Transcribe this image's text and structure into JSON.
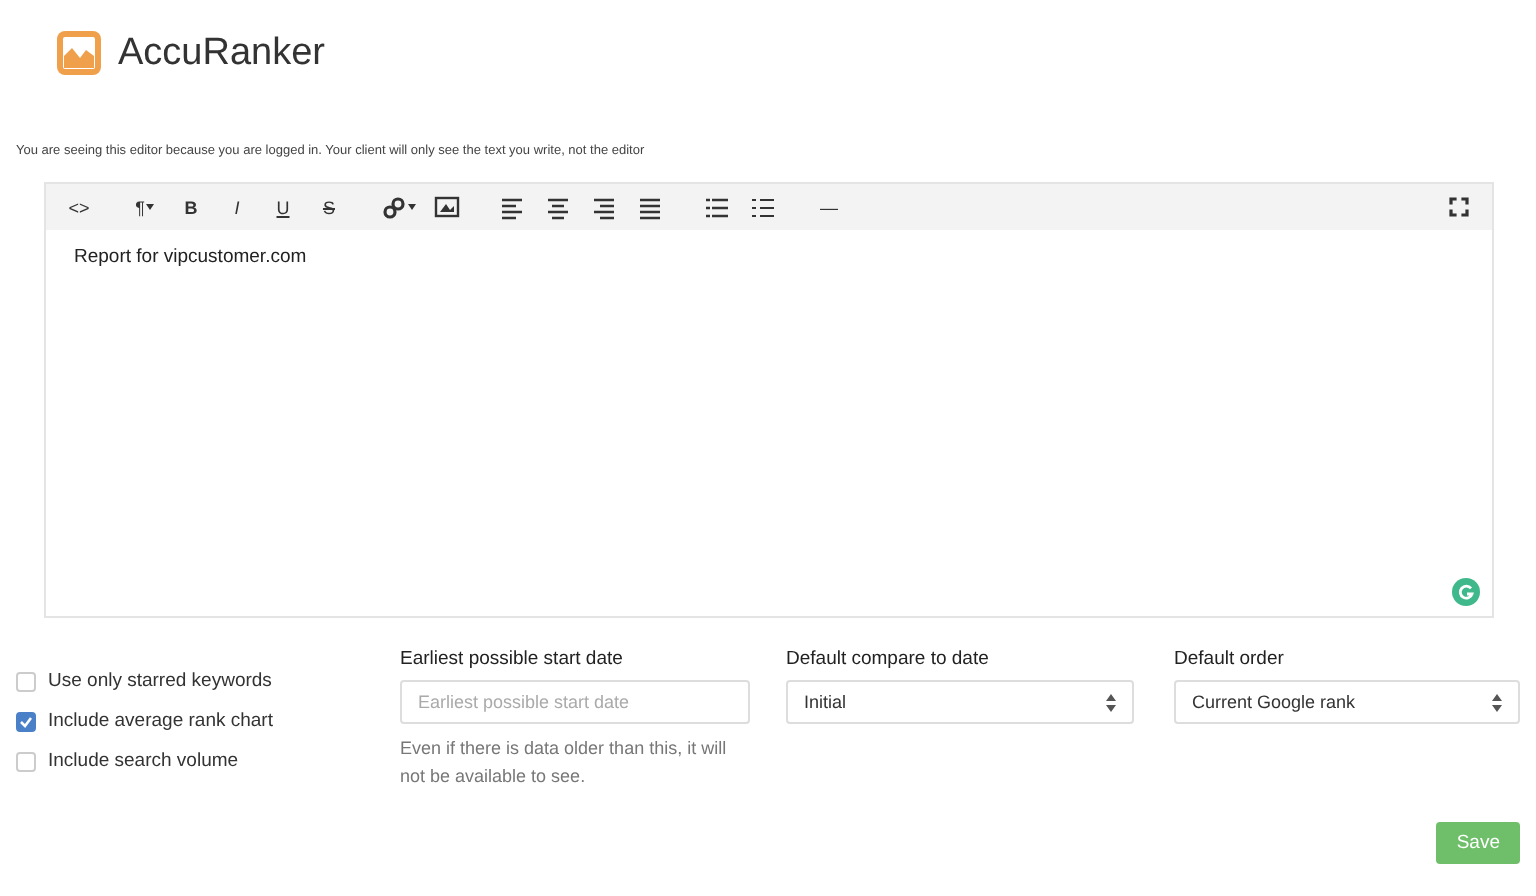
{
  "brand": {
    "name": "AccuRanker"
  },
  "notice": "You are seeing this editor because you are logged in. Your client will only see the text you write, not the editor",
  "toolbar": [
    {
      "kind": "glyph",
      "label": "<>"
    },
    {
      "kind": "glyph",
      "label": "¶",
      "caret": true
    },
    {
      "kind": "bold",
      "label": "B"
    },
    {
      "kind": "italic",
      "label": "I"
    },
    {
      "kind": "underline",
      "label": "U"
    },
    {
      "kind": "strike",
      "label": "S"
    },
    {
      "kind": "link",
      "caret": true
    },
    {
      "kind": "image"
    },
    {
      "kind": "align-left"
    },
    {
      "kind": "align-center"
    },
    {
      "kind": "align-right"
    },
    {
      "kind": "justify"
    },
    {
      "kind": "bullets"
    },
    {
      "kind": "numbers"
    },
    {
      "kind": "glyph",
      "label": "—"
    }
  ],
  "editor": {
    "content": "Report for vipcustomer.com"
  },
  "options": [
    {
      "label": "Use only starred keywords",
      "checked": false
    },
    {
      "label": "Include average rank chart",
      "checked": true
    },
    {
      "label": "Include search volume",
      "checked": false
    }
  ],
  "start_date": {
    "label": "Earliest possible start date",
    "placeholder": "Earliest possible start date",
    "help": "Even if there is data older than this, it will not be available to see."
  },
  "compare": {
    "label": "Default compare to date",
    "value": "Initial"
  },
  "order": {
    "label": "Default order",
    "value": "Current Google rank"
  },
  "save_button": "Save"
}
